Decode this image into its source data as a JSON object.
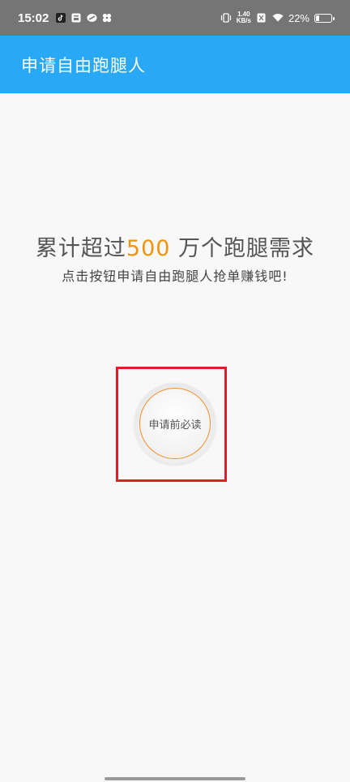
{
  "status_bar": {
    "time": "15:02",
    "net_speed_value": "1.40",
    "net_speed_unit": "KB/s",
    "battery_percent": "22%",
    "battery_level": 0.22,
    "icons_left": [
      "tiktok-icon",
      "inbox-icon",
      "app-icon",
      "fan-icon"
    ],
    "icons_right": [
      "vibrate-icon",
      "sim-icon",
      "wifi-icon",
      "battery-icon"
    ]
  },
  "app_bar": {
    "title": "申请自由跑腿人",
    "background": "#29a8f5"
  },
  "main": {
    "headline_prefix": "累计超过",
    "headline_number": "500",
    "headline_suffix": " 万个跑腿需求",
    "subline": "点击按钮申请自由跑腿人抢单赚钱吧!",
    "read_button_label": "申请前必读",
    "highlight_color": "#f0940a",
    "box_color": "#e01e2b"
  }
}
